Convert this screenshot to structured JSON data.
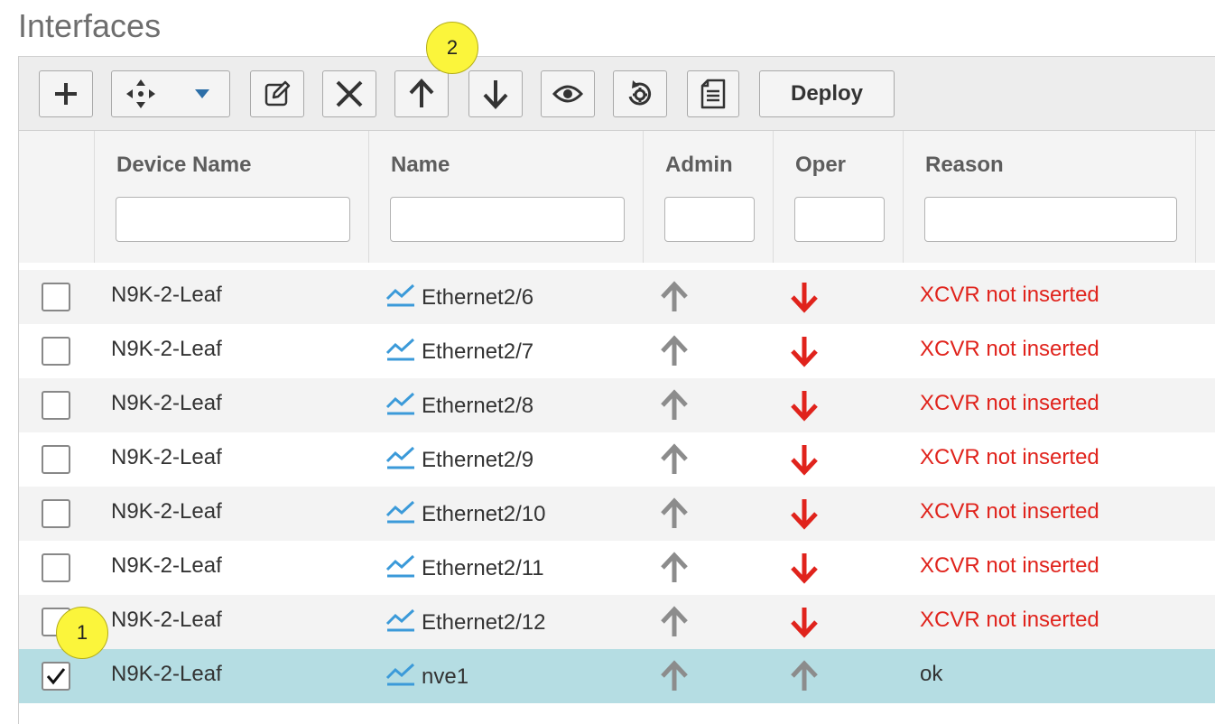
{
  "page": {
    "title": "Interfaces"
  },
  "toolbar": {
    "add_icon": "plus-icon",
    "move_icon": "move-arrows-icon",
    "edit_icon": "edit-icon",
    "delete_icon": "close-icon",
    "admin_up_icon": "arrow-up-icon",
    "admin_down_icon": "arrow-down-icon",
    "show_icon": "eye-icon",
    "rediscover_icon": "refresh-gear-icon",
    "history_icon": "document-icon",
    "deploy_label": "Deploy"
  },
  "table": {
    "columns": [
      {
        "label": "Device Name",
        "filter": ""
      },
      {
        "label": "Name",
        "filter": ""
      },
      {
        "label": "Admin",
        "filter": ""
      },
      {
        "label": "Oper",
        "filter": ""
      },
      {
        "label": "Reason",
        "filter": ""
      }
    ],
    "rows": [
      {
        "checked": false,
        "device": "N9K-2-Leaf",
        "name": "Ethernet2/6",
        "admin": "up",
        "oper": "down",
        "reason": "XCVR not inserted"
      },
      {
        "checked": false,
        "device": "N9K-2-Leaf",
        "name": "Ethernet2/7",
        "admin": "up",
        "oper": "down",
        "reason": "XCVR not inserted"
      },
      {
        "checked": false,
        "device": "N9K-2-Leaf",
        "name": "Ethernet2/8",
        "admin": "up",
        "oper": "down",
        "reason": "XCVR not inserted"
      },
      {
        "checked": false,
        "device": "N9K-2-Leaf",
        "name": "Ethernet2/9",
        "admin": "up",
        "oper": "down",
        "reason": "XCVR not inserted"
      },
      {
        "checked": false,
        "device": "N9K-2-Leaf",
        "name": "Ethernet2/10",
        "admin": "up",
        "oper": "down",
        "reason": "XCVR not inserted"
      },
      {
        "checked": false,
        "device": "N9K-2-Leaf",
        "name": "Ethernet2/11",
        "admin": "up",
        "oper": "down",
        "reason": "XCVR not inserted"
      },
      {
        "checked": false,
        "device": "N9K-2-Leaf",
        "name": "Ethernet2/12",
        "admin": "up",
        "oper": "down",
        "reason": "XCVR not inserted"
      },
      {
        "checked": true,
        "device": "N9K-2-Leaf",
        "name": "nve1",
        "admin": "up",
        "oper": "up",
        "reason": "ok"
      }
    ]
  },
  "callouts": {
    "one": "1",
    "two": "2"
  },
  "colors": {
    "down": "#e0231c",
    "up": "#8c8c8c",
    "trend": "#3b9ad9",
    "selected_row": "#b5dde3",
    "badge": "#fbf53b"
  }
}
